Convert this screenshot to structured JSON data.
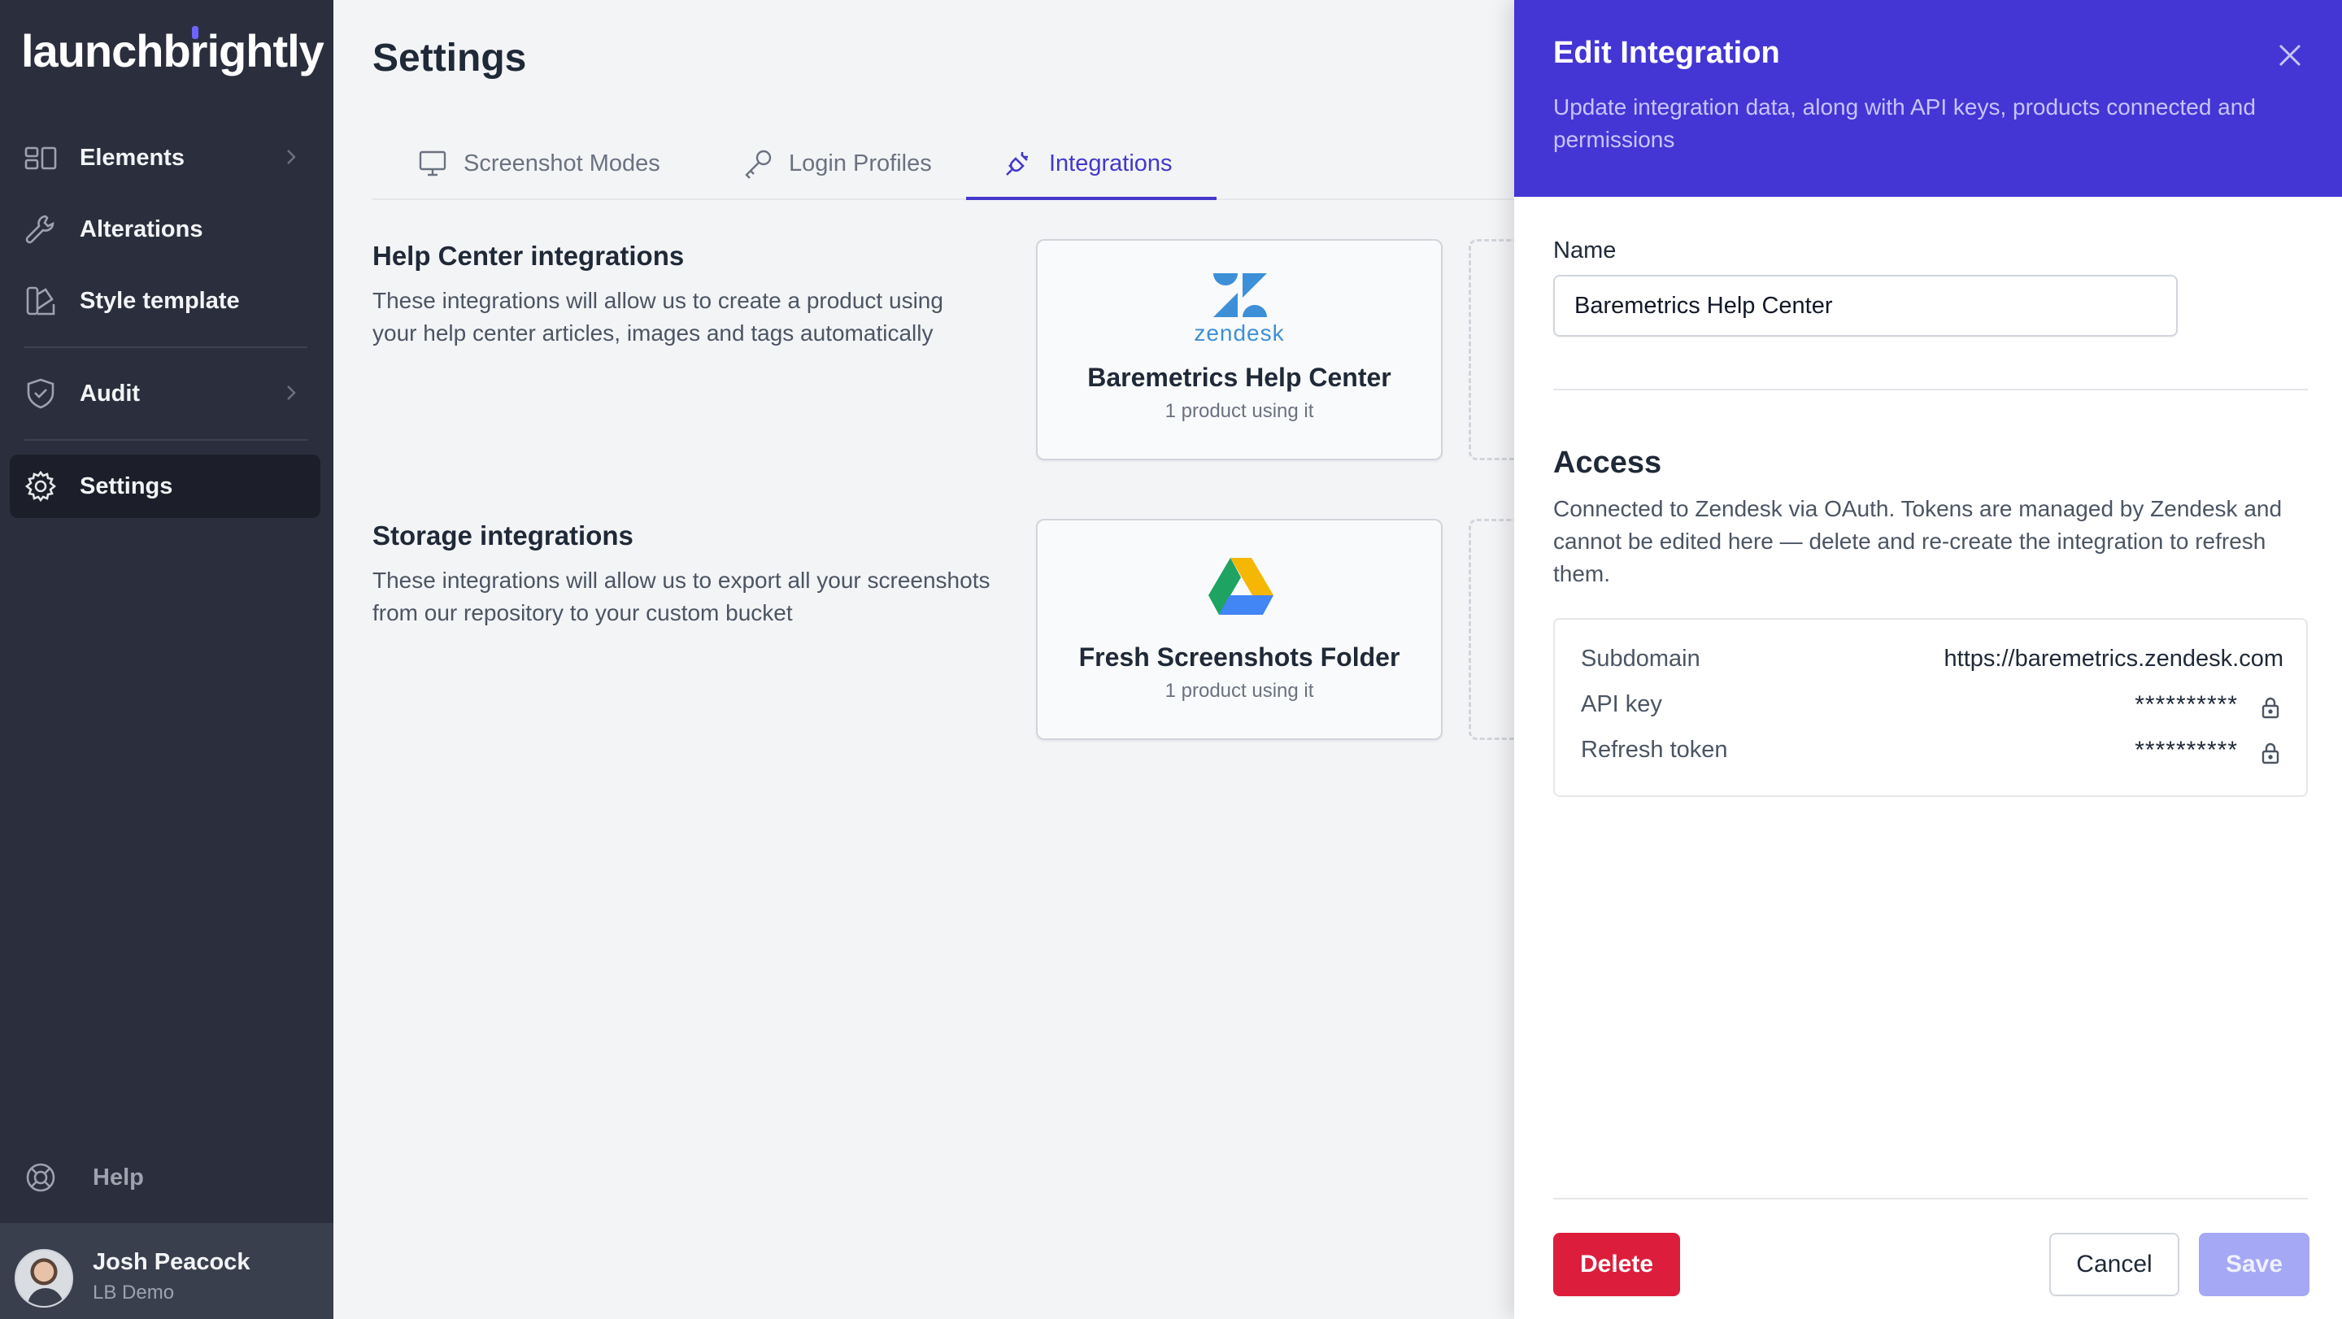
{
  "sidebar": {
    "logo": "launchbrightly",
    "items": [
      {
        "label": "Elements"
      },
      {
        "label": "Alterations"
      },
      {
        "label": "Style template"
      },
      {
        "label": "Audit"
      },
      {
        "label": "Settings"
      }
    ],
    "help_label": "Help",
    "user": {
      "name": "Josh Peacock",
      "org": "LB Demo"
    }
  },
  "main": {
    "title": "Settings",
    "tabs": [
      {
        "label": "Screenshot Modes"
      },
      {
        "label": "Login Profiles"
      },
      {
        "label": "Integrations",
        "active": true
      }
    ],
    "sections": [
      {
        "title": "Help Center integrations",
        "description": "These integrations will allow us to create a product using your help center articles, images and tags automatically",
        "card": {
          "logo_text": "zendesk",
          "title": "Baremetrics Help Center",
          "subtitle": "1 product using it"
        }
      },
      {
        "title": "Storage integrations",
        "description": "These integrations will allow us to export all your screenshots from our repository to your custom bucket",
        "card": {
          "title": "Fresh Screenshots Folder",
          "subtitle": "1 product using it"
        }
      }
    ]
  },
  "panel": {
    "title": "Edit Integration",
    "subtitle": "Update integration data, along with API keys, products connected and permissions",
    "name_label": "Name",
    "name_value": "Baremetrics Help Center",
    "access_title": "Access",
    "access_desc": "Connected to Zendesk via OAuth. Tokens are managed by Zendesk and cannot be edited here — delete and re-create the integration to refresh them.",
    "credentials": [
      {
        "key": "Subdomain",
        "value": "https://baremetrics.zendesk.com"
      },
      {
        "key": "API key",
        "value": "**********"
      },
      {
        "key": "Refresh token",
        "value": "**********"
      }
    ],
    "buttons": {
      "delete": "Delete",
      "cancel": "Cancel",
      "save": "Save"
    }
  },
  "colors": {
    "sidebar_bg": "#2b2f3d",
    "accent": "#4436d4",
    "danger": "#dc1e3c",
    "save_disabled": "#a5a8f5"
  }
}
